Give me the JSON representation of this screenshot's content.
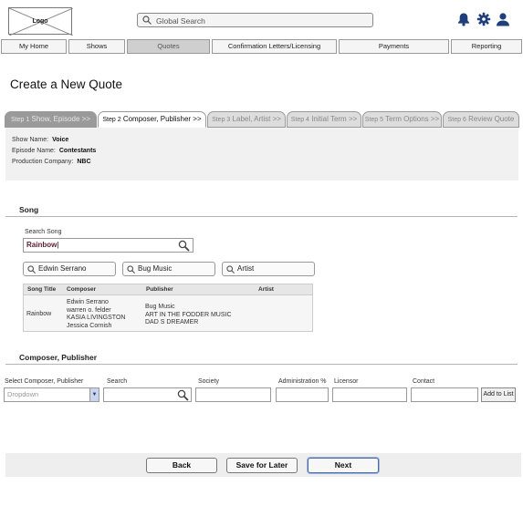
{
  "header": {
    "logo_text": "Logo",
    "search_placeholder": "Global Search",
    "icons": [
      "bell-icon",
      "gear-icon",
      "user-icon"
    ]
  },
  "nav": {
    "items": [
      {
        "label": "My Home",
        "active": false
      },
      {
        "label": "Shows",
        "active": false
      },
      {
        "label": "Quotes",
        "active": true
      },
      {
        "label": "Confirmation Letters/Licensing",
        "active": false
      },
      {
        "label": "Payments",
        "active": false
      },
      {
        "label": "Reporting",
        "active": false
      }
    ]
  },
  "page": {
    "title": "Create a New Quote"
  },
  "steps": [
    {
      "num": "Step 1",
      "label": "Show, Episode >>",
      "state": "done"
    },
    {
      "num": "Step 2",
      "label": "Composer, Publisher >>",
      "state": "current"
    },
    {
      "num": "Step 3",
      "label": "Label, Artist >>",
      "state": "pending"
    },
    {
      "num": "Step 4",
      "label": "Initial Term >>",
      "state": "pending"
    },
    {
      "num": "Step 5",
      "label": "Term Options >>",
      "state": "pending"
    },
    {
      "num": "Step 6",
      "label": "Review Quote",
      "state": "pending"
    }
  ],
  "show_info": {
    "show_name_label": "Show Name:",
    "show_name": "Voice",
    "episode_name_label": "Episode Name:",
    "episode_name": "Contestants",
    "production_company_label": "Production Company:",
    "production_company": "NBC"
  },
  "song_section": {
    "title": "Song",
    "search_label": "Search Song",
    "search_value": "Rainbow",
    "filters": [
      "Edwin Serrano",
      "Bug Music",
      "Artist"
    ],
    "table": {
      "headers": [
        "Song Title",
        "Composer",
        "Publisher",
        "Artist"
      ],
      "rows": [
        {
          "song_title": "Rainbow",
          "composers": [
            "Edwin Serrano",
            "warren o. felder",
            "KASIA LIVINGSTON",
            "Jessica Cornish"
          ],
          "publishers": [
            "Bug Music",
            "ART IN THE FODDER MUSIC",
            "DAD S DREAMER"
          ],
          "artist": ""
        }
      ]
    }
  },
  "composer_section": {
    "title": "Composer, Publisher",
    "select_label": "Select Composer, Publisher",
    "select_value": "Dropdown",
    "search_label": "Search",
    "society_label": "Society",
    "admin_label": "Administration %",
    "licensor_label": "Licensor",
    "contact_label": "Contact",
    "add_button": "Add to List"
  },
  "footer": {
    "back": "Back",
    "save": "Save for Later",
    "next": "Next"
  }
}
